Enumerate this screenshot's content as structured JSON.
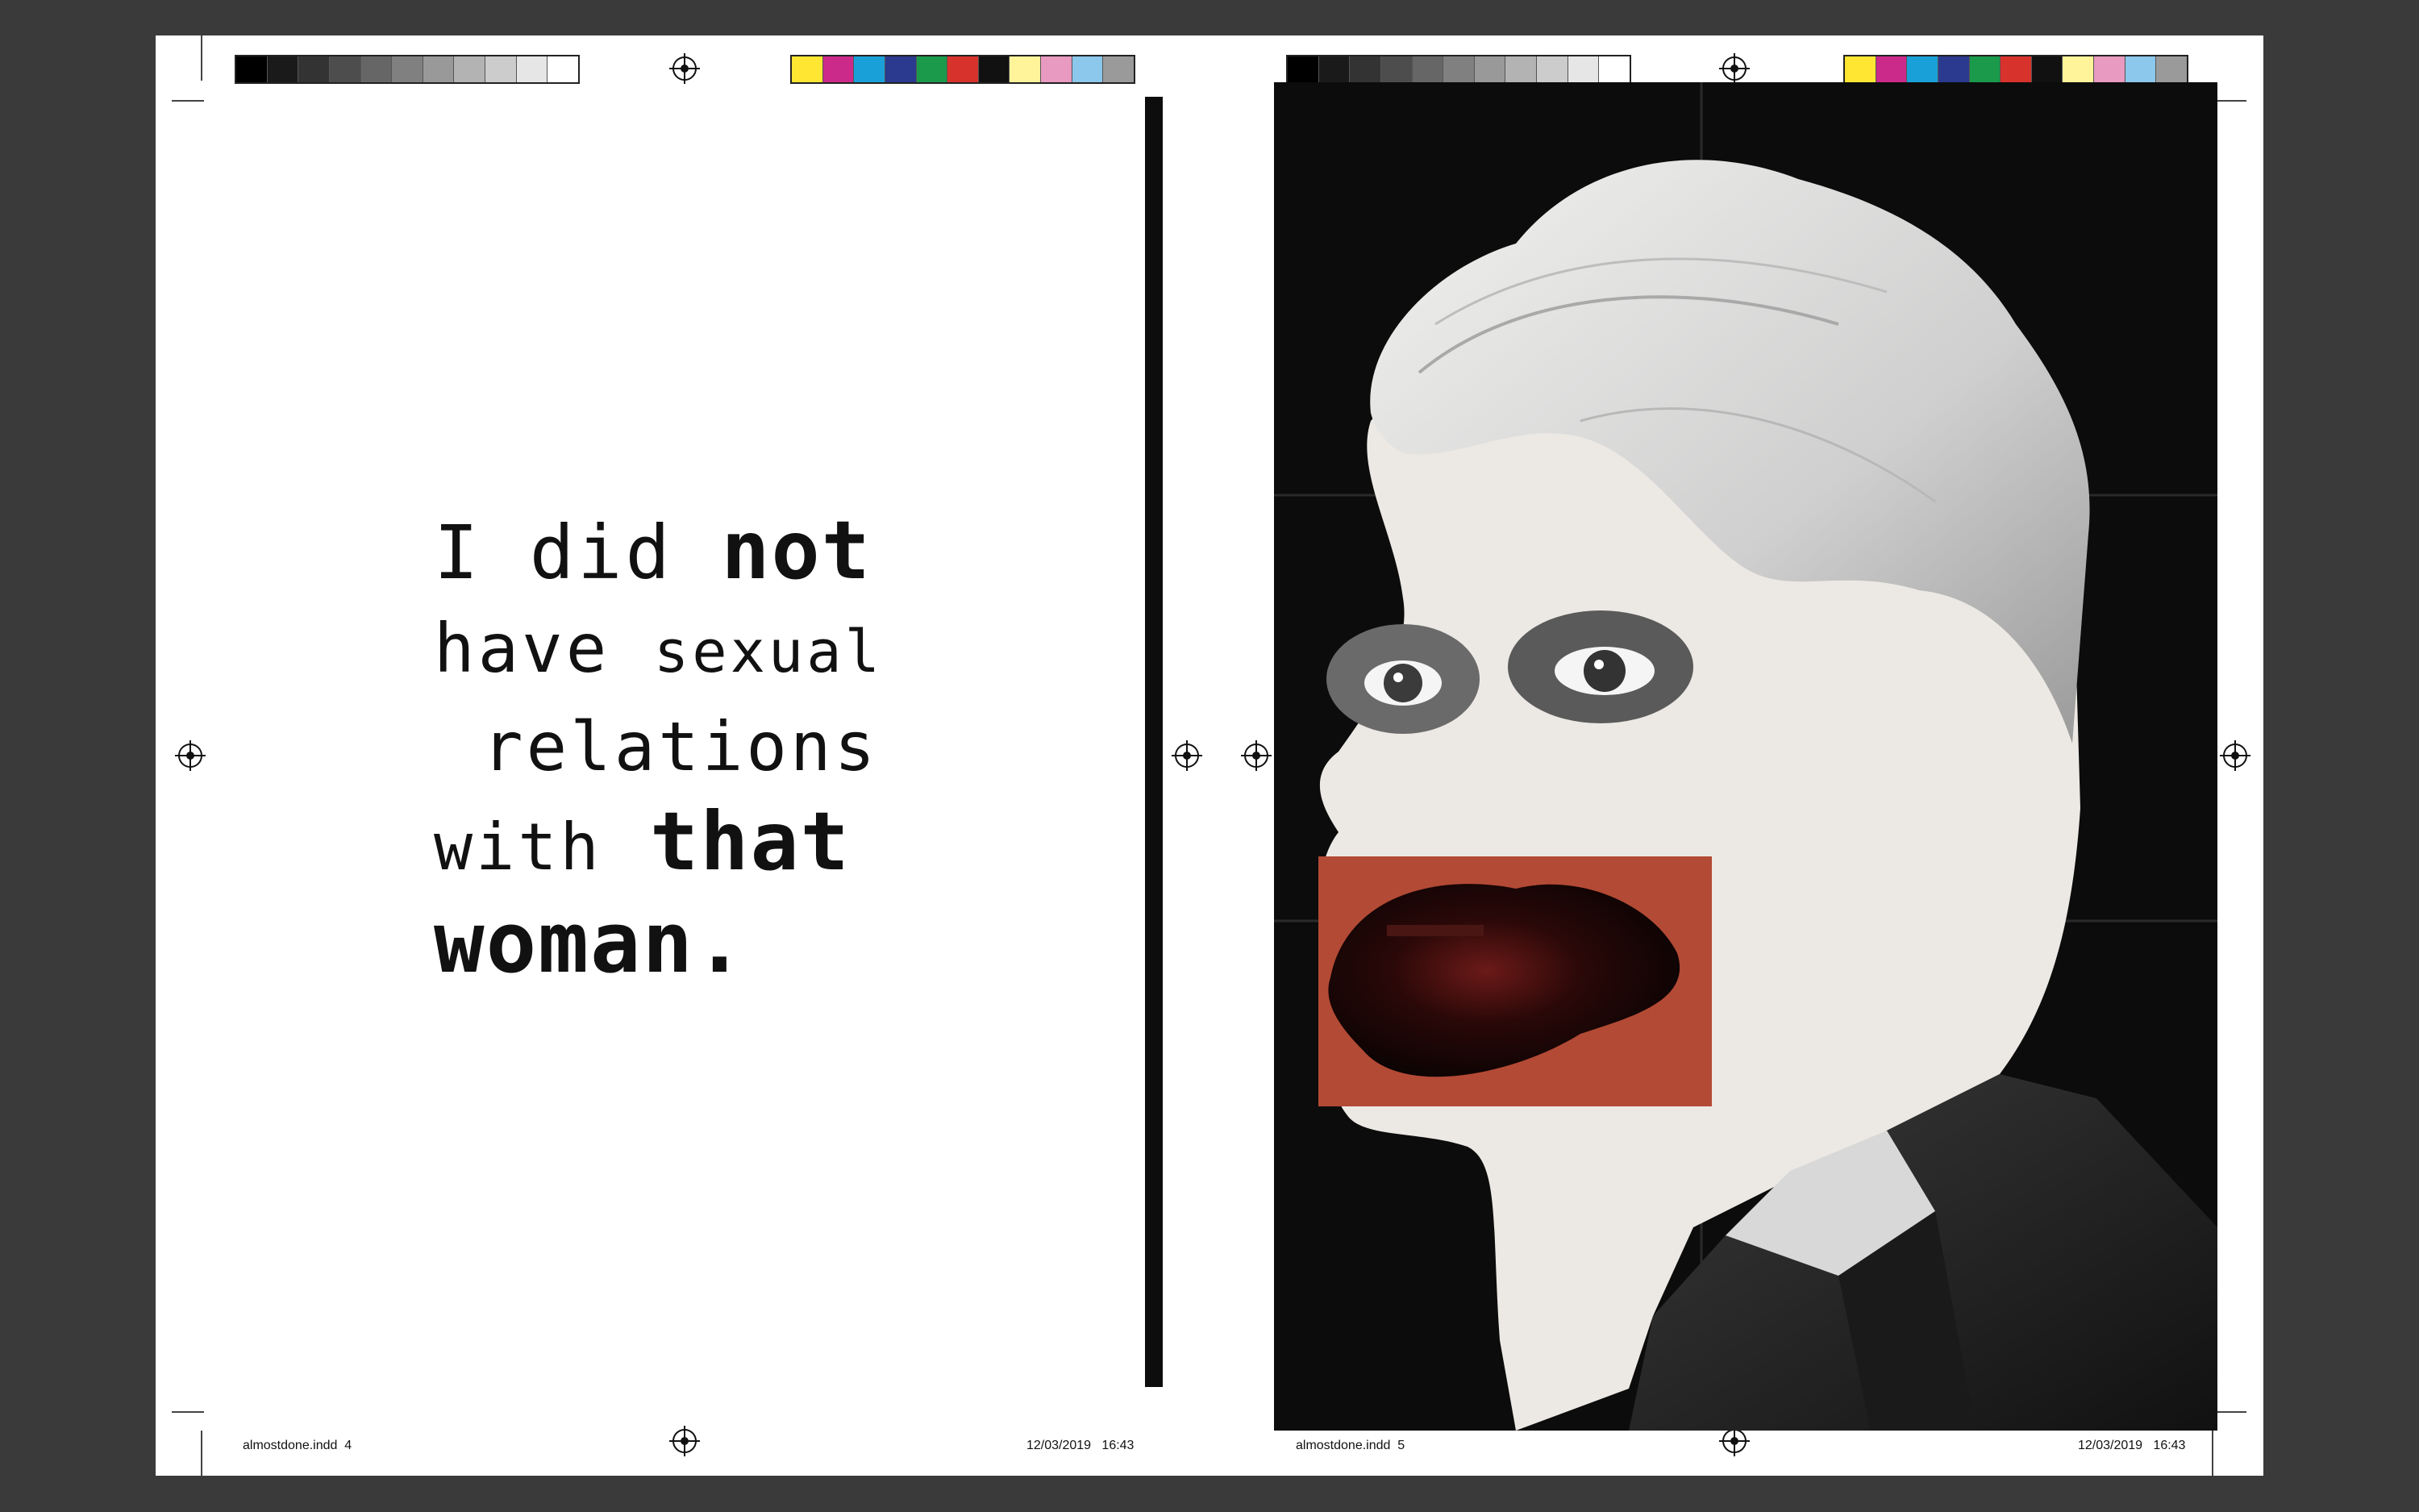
{
  "spread": {
    "left_page": {
      "slug_file": "almostdone.indd  4",
      "slug_date": "12/03/2019   16:43",
      "quote": {
        "line1_a": "I did",
        "line1_b": "not",
        "line2_a": "have",
        "line2_b": "sexual",
        "line3": "relations",
        "line4_a": "with",
        "line4_b": "that",
        "line5": "woman."
      }
    },
    "right_page": {
      "slug_file": "almostdone.indd  5",
      "slug_date": "12/03/2019   16:43"
    }
  },
  "colors": {
    "background": "#3a3a3a",
    "page": "#ffffff",
    "artwork_bg": "#0c0c0c",
    "lips_block": "#b34a35",
    "grayscale_bar": [
      "#000000",
      "#1a1a1a",
      "#333333",
      "#4d4d4d",
      "#666666",
      "#808080",
      "#999999",
      "#b3b3b3",
      "#cccccc",
      "#e6e6e6",
      "#ffffff"
    ],
    "color_bar": [
      "#ffe633",
      "#cc2a8a",
      "#1aa0d8",
      "#2b3a8f",
      "#1a9a4a",
      "#d8322c",
      "#111111",
      "#fff49a",
      "#e89ac0",
      "#8cc8ec",
      "#9a9a9a"
    ]
  },
  "icons": {
    "registration_mark": "registration-mark-icon",
    "crop_mark": "crop-mark-icon"
  }
}
